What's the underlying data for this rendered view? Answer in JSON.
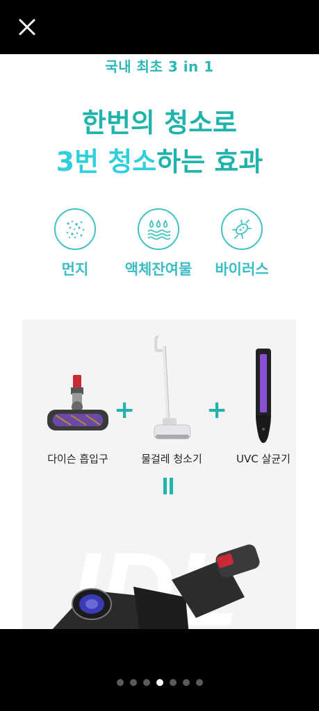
{
  "header": {
    "close_icon": "close-icon"
  },
  "page": {
    "subtitle": "국내 최초 3 in 1",
    "headline_line1": "한번의 청소로",
    "headline_line2_part1": "3번 청소",
    "headline_line2_part2": "하는 효과",
    "colors": {
      "teal": "#1fb3ab",
      "cyan": "#2fd0dc",
      "label": "#3bbcc4"
    }
  },
  "features": [
    {
      "label": "먼지",
      "icon": "dust-icon"
    },
    {
      "label": "액체잔여물",
      "icon": "liquid-icon"
    },
    {
      "label": "바이러스",
      "icon": "virus-icon"
    }
  ],
  "products": [
    {
      "label": "다이슨 흡입구",
      "icon": "vacuum-head-icon"
    },
    {
      "label": "물걸레 청소기",
      "icon": "wet-mop-icon"
    },
    {
      "label": "UVC 살균기",
      "icon": "uvc-sterilizer-icon"
    }
  ],
  "operators": {
    "plus": "+"
  },
  "carousel": {
    "count": 7,
    "active_index": 3
  }
}
